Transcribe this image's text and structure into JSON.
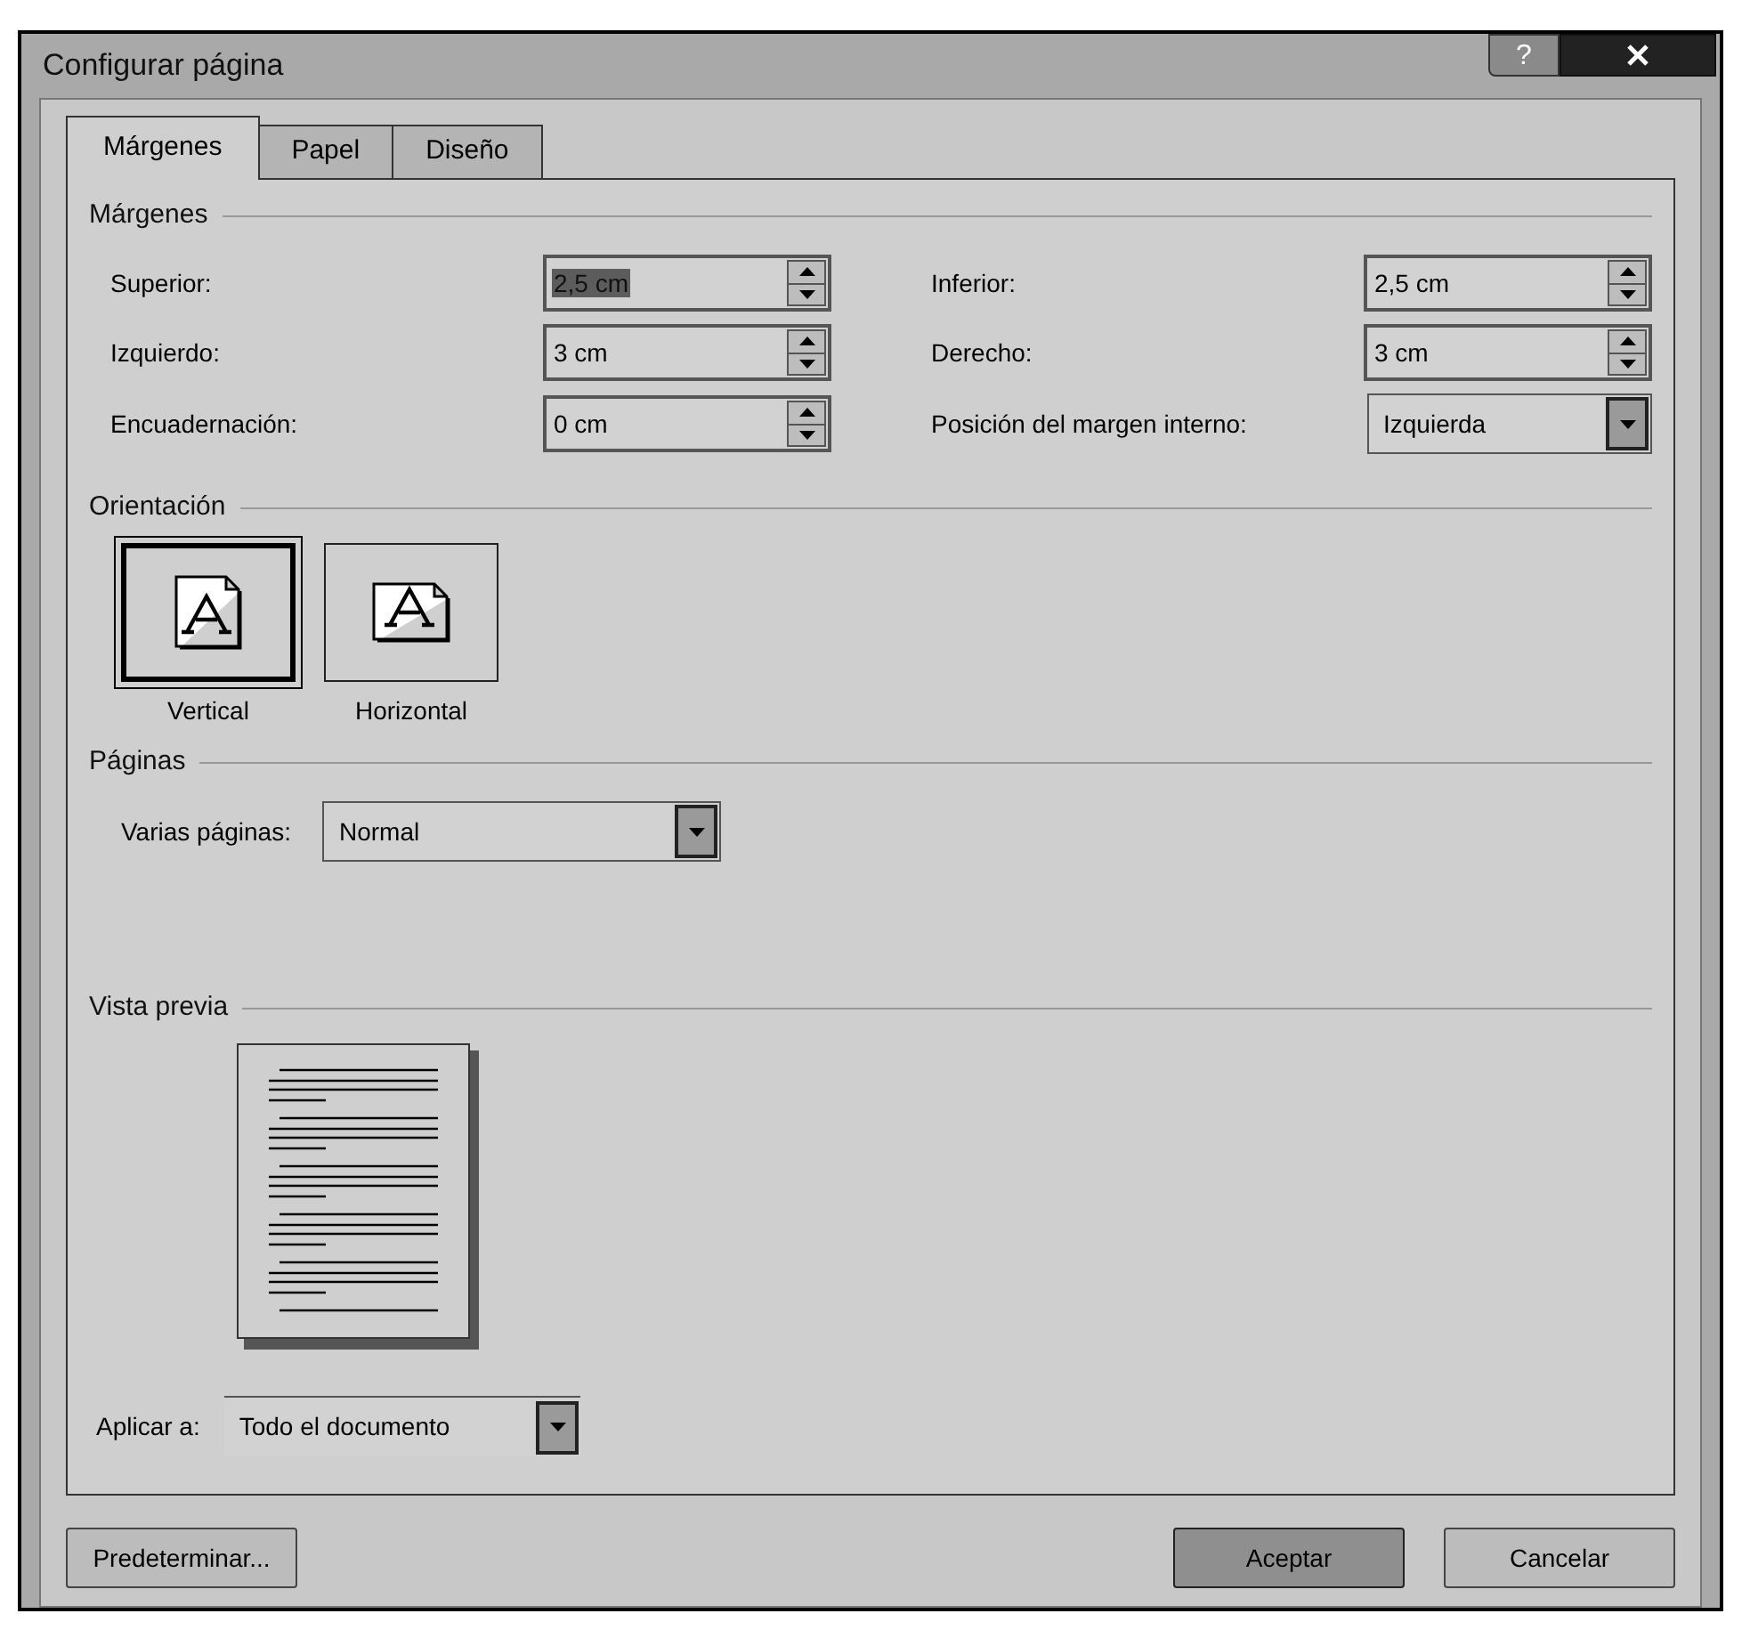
{
  "window": {
    "title": "Configurar página",
    "help": "?"
  },
  "tabs": [
    {
      "label": "Márgenes",
      "selected": true
    },
    {
      "label": "Papel",
      "selected": false
    },
    {
      "label": "Diseño",
      "selected": false
    }
  ],
  "margins": {
    "title": "Márgenes",
    "fields": [
      {
        "label": "Superior:",
        "value": "2,5 cm",
        "kind": "spin",
        "highlighted": true
      },
      {
        "label": "Inferior:",
        "value": "2,5 cm",
        "kind": "spin"
      },
      {
        "label": "Izquierdo:",
        "value": "3 cm",
        "kind": "spin"
      },
      {
        "label": "Derecho:",
        "value": "3 cm",
        "kind": "spin"
      },
      {
        "label": "Encuadernación:",
        "value": "0 cm",
        "kind": "spin"
      },
      {
        "label": "Posición del margen interno:",
        "value": "Izquierda",
        "kind": "select"
      }
    ]
  },
  "orientation": {
    "title": "Orientación",
    "options": [
      {
        "label": "Vertical",
        "kind": "portrait",
        "selected": true
      },
      {
        "label": "Horizontal",
        "kind": "landscape",
        "selected": false
      }
    ]
  },
  "pages": {
    "title": "Páginas",
    "label": "Varias páginas:",
    "value": "Normal"
  },
  "preview": {
    "title": "Vista previa"
  },
  "apply_to": {
    "label": "Aplicar a:",
    "value": "Todo el documento"
  },
  "left_buttons": [
    {
      "label": "Predeterminar...",
      "default": false
    }
  ],
  "buttons": [
    {
      "label": "Aceptar",
      "default": true
    },
    {
      "label": "Cancelar",
      "default": false
    }
  ]
}
